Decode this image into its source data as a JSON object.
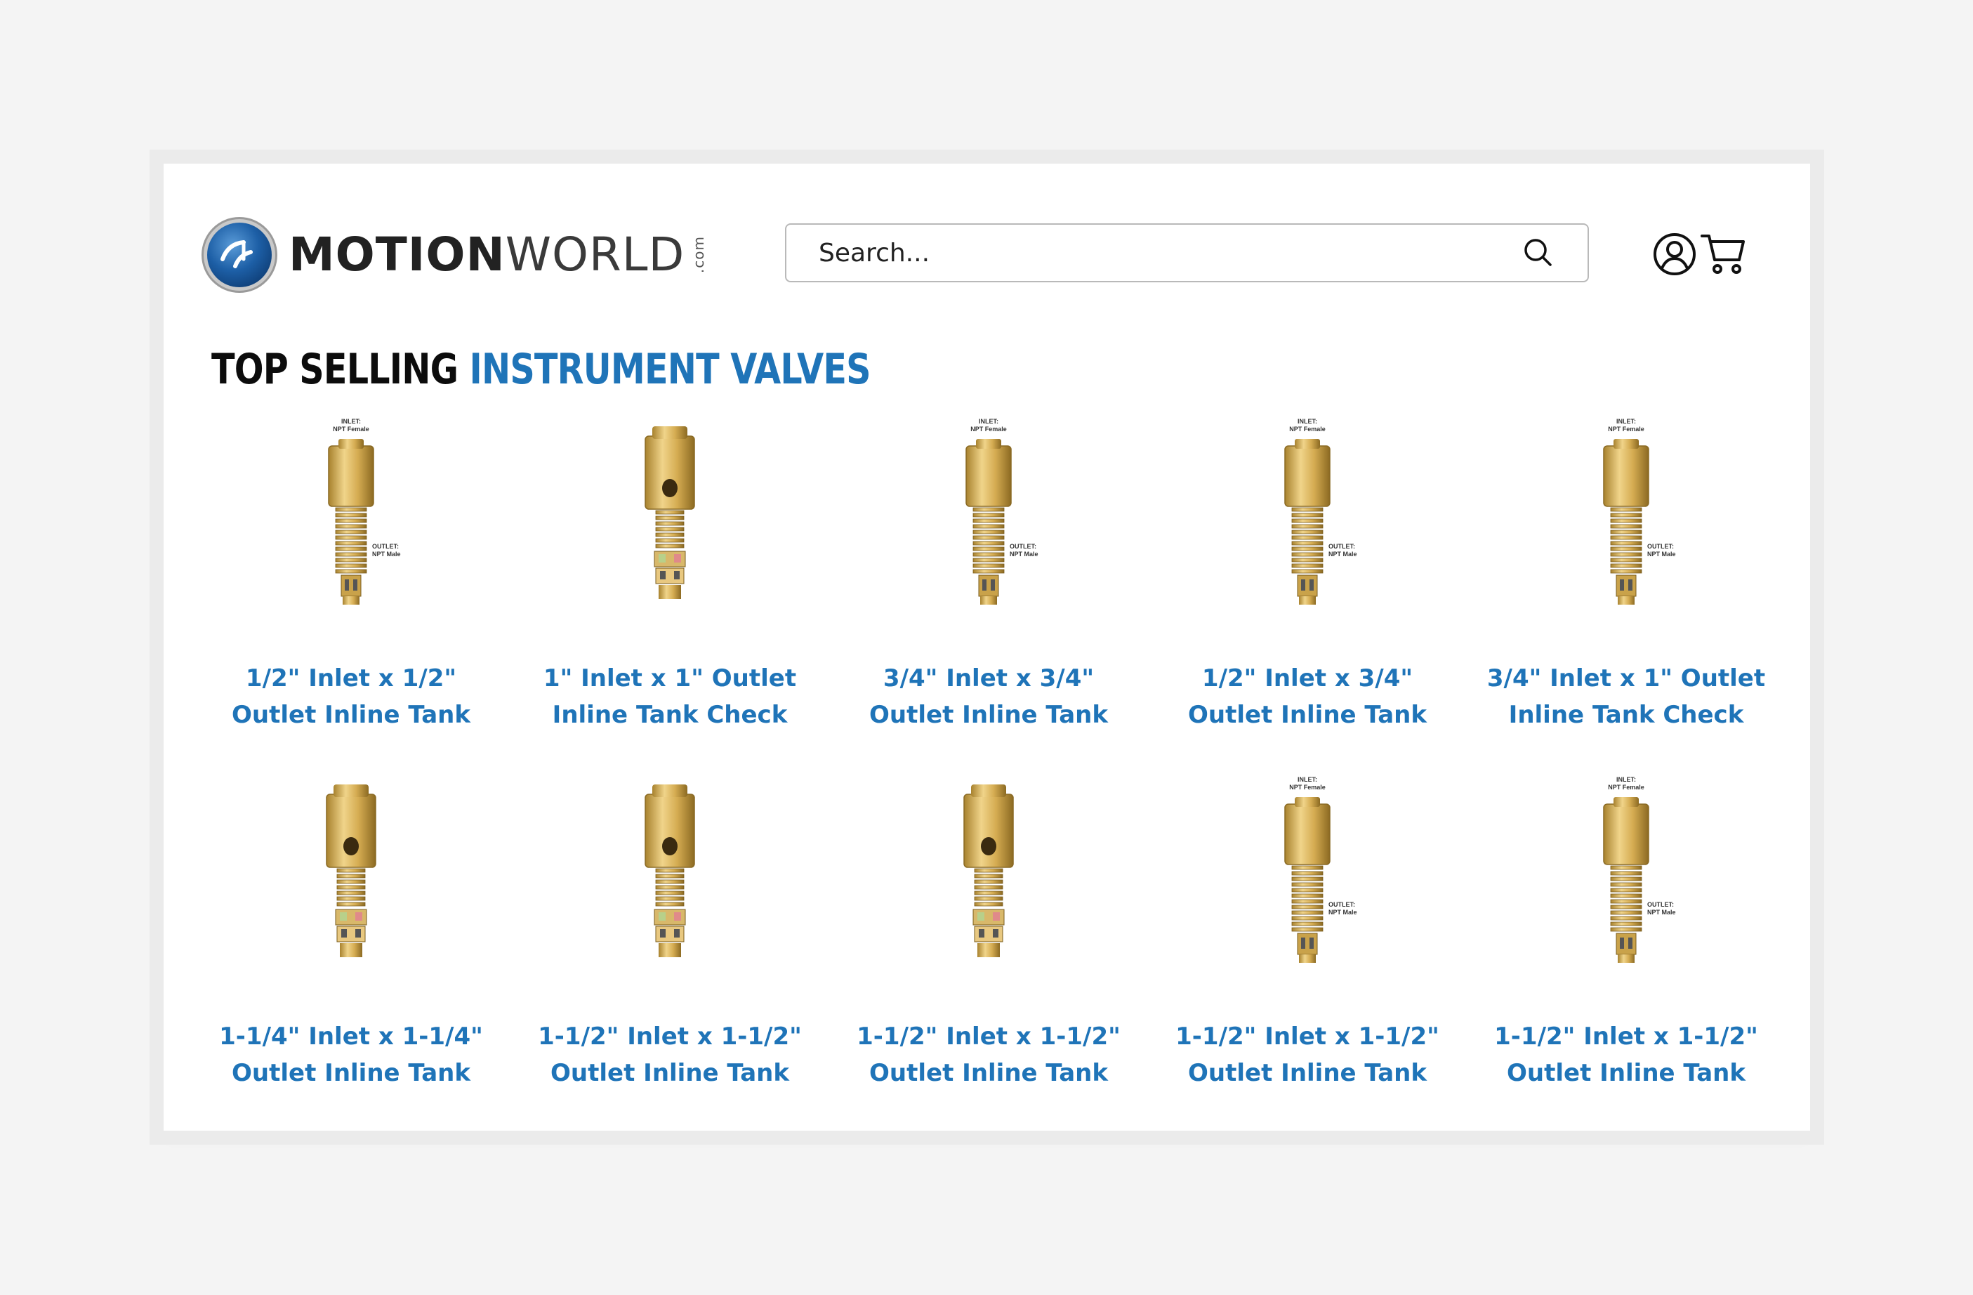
{
  "header": {
    "logo": {
      "text_bold": "MOTION",
      "text_thin": "WORLD",
      "suffix": ".com"
    },
    "search": {
      "placeholder": "Search..."
    },
    "icons": {
      "search": "search-icon",
      "account": "user-icon",
      "cart": "cart-icon"
    }
  },
  "section": {
    "title_part1": "TOP SELLING ",
    "title_part2": "INSTRUMENT VALVES"
  },
  "products": [
    {
      "line1": "1/2\" Inlet x 1/2\"",
      "line2": "Outlet Inline Tank",
      "image_style": "labeled"
    },
    {
      "line1": "1\" Inlet x 1\" Outlet",
      "line2": "Inline Tank Check",
      "image_style": "ported"
    },
    {
      "line1": "3/4\" Inlet x 3/4\"",
      "line2": "Outlet Inline Tank",
      "image_style": "labeled"
    },
    {
      "line1": "1/2\" Inlet x 3/4\"",
      "line2": "Outlet Inline Tank",
      "image_style": "labeled"
    },
    {
      "line1": "3/4\" Inlet x 1\" Outlet",
      "line2": "Inline Tank Check",
      "image_style": "labeled"
    },
    {
      "line1": "1-1/4\" Inlet x 1-1/4\"",
      "line2": "Outlet Inline Tank",
      "image_style": "ported"
    },
    {
      "line1": "1-1/2\" Inlet x 1-1/2\"",
      "line2": "Outlet Inline Tank",
      "image_style": "ported"
    },
    {
      "line1": "1-1/2\" Inlet x 1-1/2\"",
      "line2": "Outlet Inline Tank",
      "image_style": "ported"
    },
    {
      "line1": "1-1/2\" Inlet x 1-1/2\"",
      "line2": "Outlet Inline Tank",
      "image_style": "labeled"
    },
    {
      "line1": "1-1/2\" Inlet x 1-1/2\"",
      "line2": "Outlet Inline Tank",
      "image_style": "labeled"
    }
  ],
  "image_labels": {
    "inlet": "INLET:",
    "inlet_type": "NPT Female",
    "outlet": "OUTLET:",
    "outlet_type": "NPT Male"
  },
  "colors": {
    "accent_blue": "#1f74b8",
    "brass": "#d9b45a",
    "background": "#f4f4f4"
  }
}
